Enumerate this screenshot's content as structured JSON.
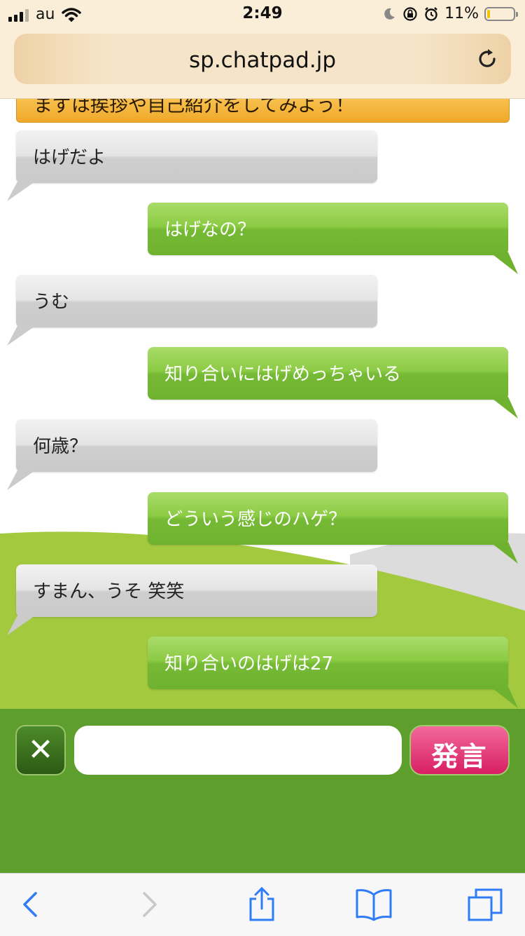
{
  "status_bar": {
    "carrier": "au",
    "time": "2:49",
    "battery_percent": "11%",
    "battery_level": 0.11,
    "icons": [
      "signal-icon",
      "wifi-icon",
      "moon-icon",
      "orientation-lock-icon",
      "alarm-icon",
      "battery-icon"
    ]
  },
  "browser": {
    "url": "sp.chatpad.jp",
    "reload_icon": "reload-icon"
  },
  "chat": {
    "notice": "まずは挨拶や自己紹介をしてみよう！",
    "messages": [
      {
        "side": "left",
        "text": "はげだよ"
      },
      {
        "side": "right",
        "text": "はげなの？"
      },
      {
        "side": "left",
        "text": "うむ"
      },
      {
        "side": "right",
        "text": "知り合いにはげめっちゃいる"
      },
      {
        "side": "left",
        "text": "何歳？"
      },
      {
        "side": "right",
        "text": "どういう感じのハゲ？"
      },
      {
        "side": "left",
        "text": "すまん、うそ 笑笑"
      },
      {
        "side": "right",
        "text": "知り合いのはげは27"
      }
    ]
  },
  "input_bar": {
    "clear_label": "✕",
    "message_value": "",
    "send_label": "発言"
  },
  "toolbar": {
    "icons": [
      "back-icon",
      "forward-icon",
      "share-icon",
      "bookmarks-icon",
      "tabs-icon"
    ]
  },
  "colors": {
    "left_bubble": "#d6d6d6",
    "right_bubble": "#7cbf38",
    "input_bar": "#5e9e2c",
    "send_button": "#e2347a",
    "notice": "#f7b843"
  }
}
